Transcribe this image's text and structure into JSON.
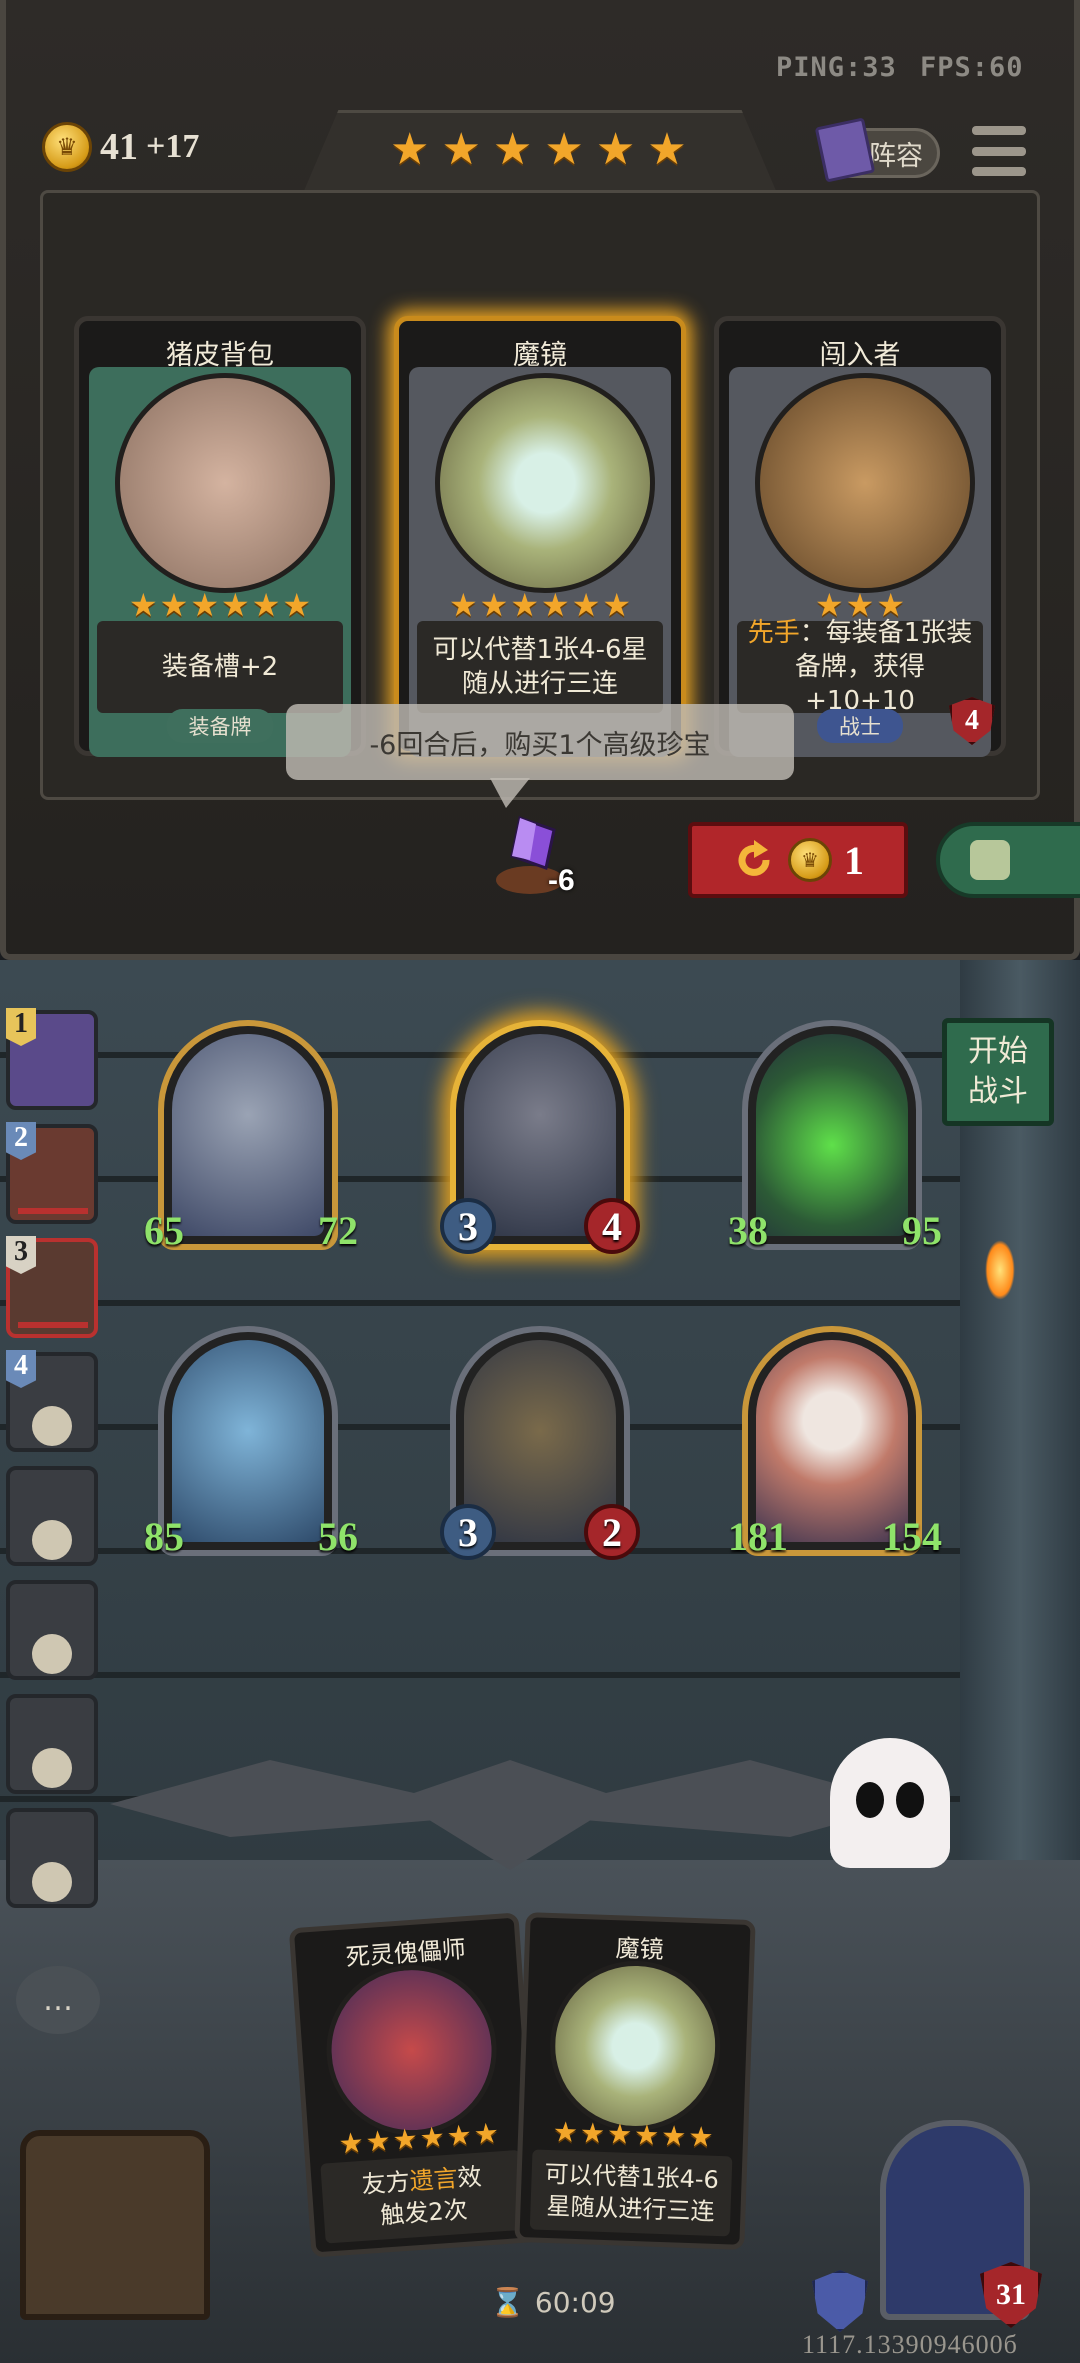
{
  "hud": {
    "ping": "PING:33",
    "fps": "FPS:60",
    "gold": "41",
    "gold_income": "+17",
    "lineup": "阵容",
    "tier_stars": 6
  },
  "shop": {
    "cards": [
      {
        "title": "猪皮背包",
        "stars": 6,
        "desc": "装备槽+2",
        "tag": "装备牌",
        "frame": "#3d6e5c",
        "art": "#b89a86"
      },
      {
        "title": "魔镜",
        "stars": 6,
        "desc": "可以代替1张4-6星随从进行三连",
        "tag": "",
        "frame": "#55585f",
        "art": "#a9b37a"
      },
      {
        "title": "闯入者",
        "stars": 3,
        "desc_prefix": "先手",
        "desc": "：每装备1张装备牌，获得+10+10",
        "tag": "战士",
        "badge": "4",
        "frame": "#55585f",
        "art": "#8a6a42"
      }
    ],
    "tooltip": "-6回合后，购买1个高级珍宝",
    "gem_count": "-6",
    "refresh_cost": "1"
  },
  "start_button": {
    "line1": "开始",
    "line2": "战斗"
  },
  "board": [
    {
      "atk": "65",
      "hp": "72",
      "style": "gold",
      "stat": "green"
    },
    {
      "atk": "3",
      "hp": "4",
      "style": "glow",
      "stat": "std"
    },
    {
      "atk": "38",
      "hp": "95",
      "style": "silver",
      "stat": "green"
    },
    {
      "atk": "85",
      "hp": "56",
      "style": "silver",
      "stat": "green"
    },
    {
      "atk": "3",
      "hp": "2",
      "style": "silver",
      "stat": "std"
    },
    {
      "atk": "181",
      "hp": "154",
      "style": "gold",
      "stat": "green"
    }
  ],
  "players": [
    {
      "num": "1"
    },
    {
      "num": "2"
    },
    {
      "num": "3"
    },
    {
      "num": "4"
    },
    {
      "num": ""
    },
    {
      "num": ""
    },
    {
      "num": ""
    },
    {
      "num": ""
    }
  ],
  "hand": [
    {
      "title": "死灵傀儡师",
      "stars": 6,
      "desc_a": "友方",
      "desc_hl": "遗言",
      "desc_b": "效",
      "desc_c": "触发2次"
    },
    {
      "title": "魔镜",
      "stars": 6,
      "desc": "可以代替1张4-6星随从进行三连"
    }
  ],
  "timer": "60:09",
  "hero_hp": "31",
  "id_text": "1117.1339094600б"
}
